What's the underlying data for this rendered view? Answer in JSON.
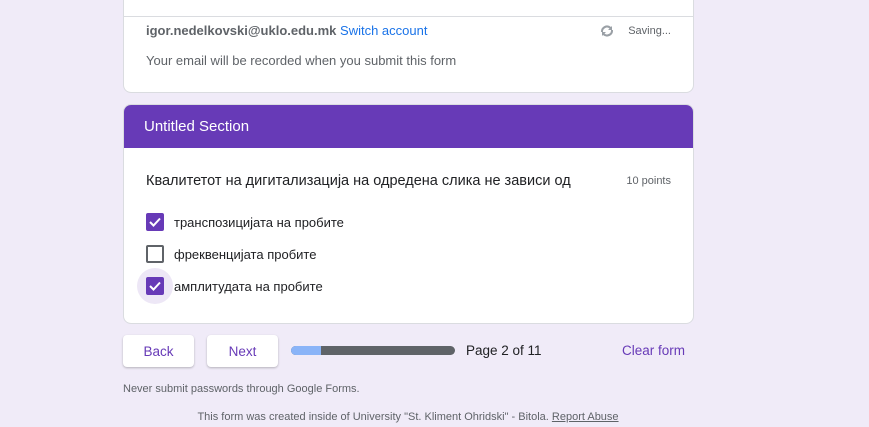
{
  "account": {
    "email": "igor.nedelkovski@uklo.edu.mk",
    "switch_label": "Switch account",
    "status": "Saving...",
    "note": "Your email will be recorded when you submit this form"
  },
  "section": {
    "title": "Untitled Section",
    "question": "Квалитетот на дигитализација на одредена слика не зависи од",
    "points": "10 points",
    "options": [
      {
        "label": "транспозицијата на пробите",
        "checked": true
      },
      {
        "label": "фреквенцијата пробите",
        "checked": false
      },
      {
        "label": "амплитудата на пробите",
        "checked": true
      }
    ]
  },
  "nav": {
    "back": "Back",
    "next": "Next",
    "page": "Page 2 of 11",
    "progress_percent": 18,
    "clear": "Clear form"
  },
  "footer": {
    "warning": "Never submit passwords through Google Forms.",
    "created": "This form was created inside of University \"St. Kliment Ohridski\" - Bitola.",
    "report": "Report Abuse"
  }
}
